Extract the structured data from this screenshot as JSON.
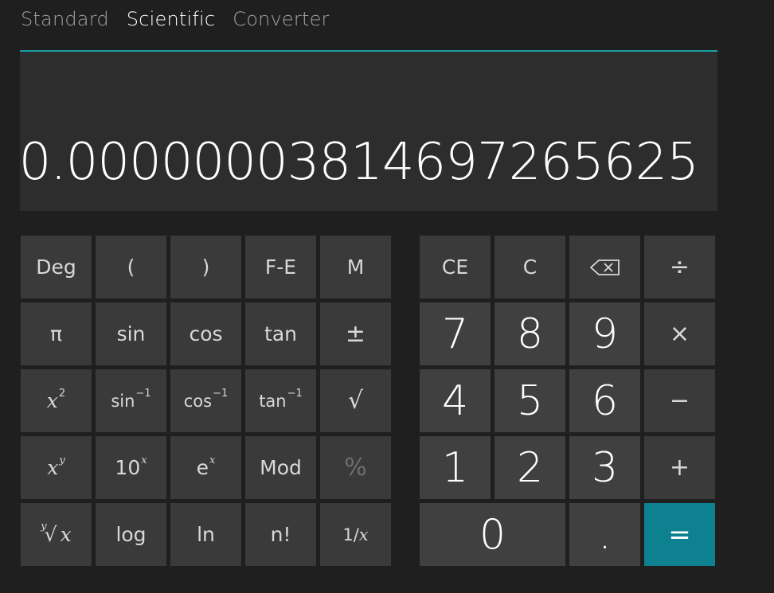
{
  "tabs": [
    {
      "label": "Standard"
    },
    {
      "label": "Scientific"
    },
    {
      "label": "Converter"
    }
  ],
  "active_tab": "Scientific",
  "display": {
    "value": "0.00000003814697265625"
  },
  "colors": {
    "accent": "#1a9fa6",
    "equals": "#0e8191",
    "background": "#1f1f1f",
    "display_bg": "#2d2d2d",
    "key_bg": "#3a3a3a",
    "digit_bg": "#404040"
  },
  "scientific_keys": {
    "deg": "Deg",
    "lparen": "(",
    "rparen": ")",
    "fe": "F-E",
    "mem": "M",
    "pi": "π",
    "sin": "sin",
    "cos": "cos",
    "tan": "tan",
    "plusminus": "±",
    "x": "x",
    "sq_exp": "2",
    "sin_base": "sin",
    "cos_base": "cos",
    "tan_base": "tan",
    "inv_exp": "−1",
    "sqrt": "√",
    "xy_base": "x",
    "xy_exp": "y",
    "ten_base": "10",
    "ten_exp": "x",
    "e_base": "e",
    "e_exp": "x",
    "mod": "Mod",
    "percent": "%",
    "root_idx": "y",
    "root_sym": "√",
    "root_x": "x",
    "log": "log",
    "ln": "ln",
    "factorial": "n!",
    "reciprocal": "1/",
    "recip_x": "x"
  },
  "number_pad": {
    "ce": "CE",
    "c": "C",
    "backspace_icon": "backspace-icon",
    "divide": "÷",
    "seven": "7",
    "eight": "8",
    "nine": "9",
    "multiply": "×",
    "four": "4",
    "five": "5",
    "six": "6",
    "minus": "−",
    "one": "1",
    "two": "2",
    "three": "3",
    "plus": "+",
    "zero": "0",
    "decimal": ".",
    "equals": "="
  }
}
